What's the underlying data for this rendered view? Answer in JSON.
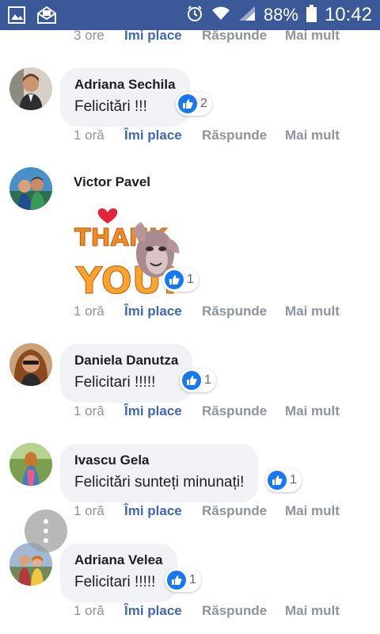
{
  "status_bar": {
    "battery": "88%",
    "time": "10:42"
  },
  "actions": {
    "like": "Îmi place",
    "reply": "Răspunde",
    "more": "Mai mult"
  },
  "comments": [
    {
      "time": "3 ore"
    },
    {
      "author": "Adriana Sechila",
      "text": "Felicitări !!!",
      "likes": "2",
      "time": "1 oră"
    },
    {
      "author": "Victor Pavel",
      "sticker": "thank-you-sticker",
      "likes": "1",
      "time": "1 oră"
    },
    {
      "author": "Daniela Danutza",
      "text": "Felicitari !!!!!",
      "likes": "1",
      "time": "1 oră"
    },
    {
      "author": "Ivascu Gela",
      "text": "Felicitări sunteți minunați!",
      "likes": "1",
      "time": "1 oră"
    },
    {
      "author": "Adriana Velea",
      "text": "Felicitari !!!!!",
      "likes": "1",
      "time": "1 oră"
    }
  ],
  "sticker_text": {
    "line1": "THANK",
    "line2": "YOU!"
  },
  "colors": {
    "status_bar": "#3b5998",
    "like_blue": "#1877f2",
    "link_blue": "#4267b2",
    "bubble": "#f0f2f5"
  }
}
